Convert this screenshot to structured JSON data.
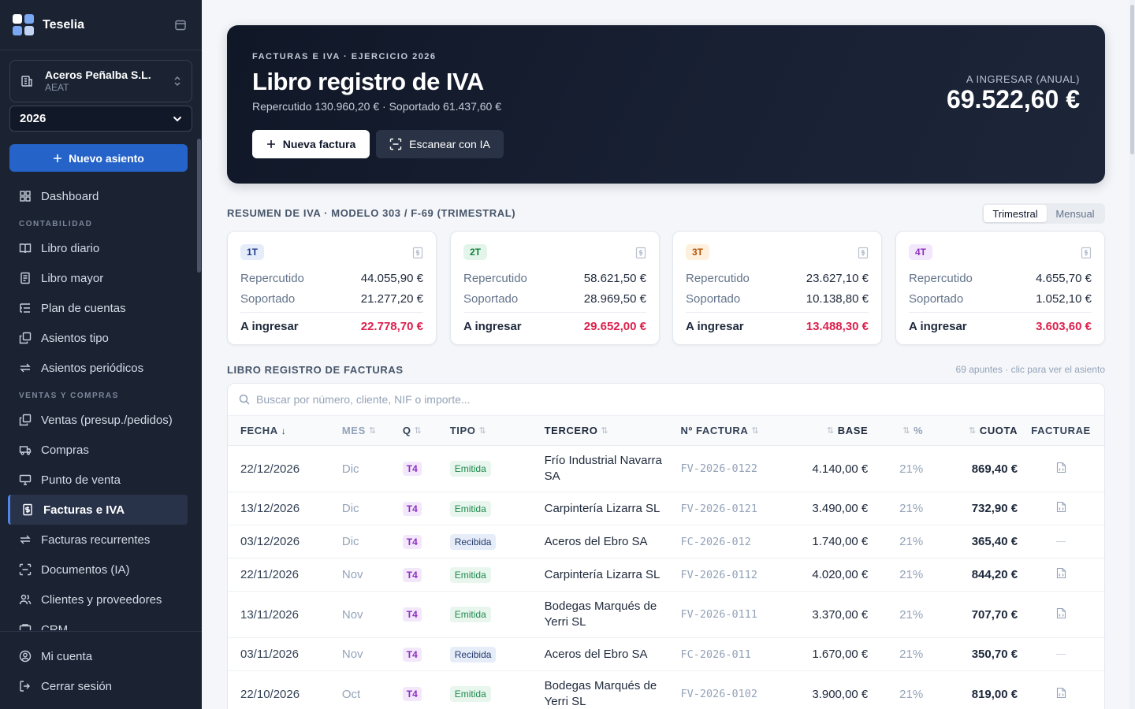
{
  "brand": {
    "name": "Teselia",
    "colors": [
      "#ffffff",
      "#7aa7f2",
      "#7aa7f2",
      "#c2d4f4"
    ]
  },
  "company": {
    "name": "Aceros Peñalba S.L.",
    "sub": "AEAT"
  },
  "year": "2026",
  "new_entry_label": "Nuevo asiento",
  "nav": {
    "dashboard": "Dashboard",
    "section_contabilidad": "CONTABILIDAD",
    "libro_diario": "Libro diario",
    "libro_mayor": "Libro mayor",
    "plan_cuentas": "Plan de cuentas",
    "asientos_tipo": "Asientos tipo",
    "asientos_periodicos": "Asientos periódicos",
    "section_ventas": "VENTAS Y COMPRAS",
    "ventas": "Ventas (presup./pedidos)",
    "compras": "Compras",
    "punto_venta": "Punto de venta",
    "facturas_iva": "Facturas e IVA",
    "facturas_recurrentes": "Facturas recurrentes",
    "documentos": "Documentos (IA)",
    "clientes": "Clientes y proveedores",
    "crm": "CRM",
    "mi_cuenta": "Mi cuenta",
    "cerrar_sesion": "Cerrar sesión"
  },
  "hero": {
    "eyebrow": "FACTURAS E IVA · EJERCICIO 2026",
    "title": "Libro registro de IVA",
    "subtitle": "Repercutido 130.960,20 € · Soportado 61.437,60 €",
    "btn_new": "Nueva factura",
    "btn_scan": "Escanear con IA",
    "total_label": "A INGRESAR (ANUAL)",
    "total_value": "69.522,60 €"
  },
  "summary": {
    "title": "RESUMEN DE IVA · MODELO 303 / F-69 (TRIMESTRAL)",
    "toggle_on": "Trimestral",
    "toggle_off": "Mensual",
    "labels": {
      "rep": "Repercutido",
      "sop": "Soportado",
      "ing": "A ingresar"
    },
    "quarters": [
      {
        "name": "1T",
        "color": "#1e3a8a",
        "bg": "#e5edfb",
        "rep": "44.055,90 €",
        "sop": "21.277,20 €",
        "ing": "22.778,70 €"
      },
      {
        "name": "2T",
        "color": "#15803d",
        "bg": "#e3f5ea",
        "rep": "58.621,50 €",
        "sop": "28.969,50 €",
        "ing": "29.652,00 €"
      },
      {
        "name": "3T",
        "color": "#b45309",
        "bg": "#fdf1de",
        "rep": "23.627,10 €",
        "sop": "10.138,80 €",
        "ing": "13.488,30 €"
      },
      {
        "name": "4T",
        "color": "#8e2fc2",
        "bg": "#f3e8fb",
        "rep": "4.655,70 €",
        "sop": "1.052,10 €",
        "ing": "3.603,60 €"
      }
    ]
  },
  "register": {
    "title": "LIBRO REGISTRO DE FACTURAS",
    "note": "69 apuntes · clic para ver el asiento",
    "search_placeholder": "Buscar por número, cliente, NIF o importe...",
    "columns": {
      "fecha": "FECHA",
      "mes": "MES",
      "q": "Q",
      "tipo": "TIPO",
      "tercero": "TERCERO",
      "num": "Nº FACTURA",
      "base": "BASE",
      "pct": "%",
      "cuota": "CUOTA",
      "facturae": "FACTURAE"
    },
    "rows": [
      {
        "fecha": "22/12/2026",
        "mes": "Dic",
        "q": "T4",
        "tipo": "Emitida",
        "tercero": "Frío Industrial Navarra SA",
        "num": "FV-2026-0122",
        "base": "4.140,00 €",
        "pct": "21%",
        "cuota": "869,40 €"
      },
      {
        "fecha": "13/12/2026",
        "mes": "Dic",
        "q": "T4",
        "tipo": "Emitida",
        "tercero": "Carpintería Lizarra SL",
        "num": "FV-2026-0121",
        "base": "3.490,00 €",
        "pct": "21%",
        "cuota": "732,90 €"
      },
      {
        "fecha": "03/12/2026",
        "mes": "Dic",
        "q": "T4",
        "tipo": "Recibida",
        "tercero": "Aceros del Ebro SA",
        "num": "FC-2026-012",
        "base": "1.740,00 €",
        "pct": "21%",
        "cuota": "365,40 €"
      },
      {
        "fecha": "22/11/2026",
        "mes": "Nov",
        "q": "T4",
        "tipo": "Emitida",
        "tercero": "Carpintería Lizarra SL",
        "num": "FV-2026-0112",
        "base": "4.020,00 €",
        "pct": "21%",
        "cuota": "844,20 €"
      },
      {
        "fecha": "13/11/2026",
        "mes": "Nov",
        "q": "T4",
        "tipo": "Emitida",
        "tercero": "Bodegas Marqués de Yerri SL",
        "num": "FV-2026-0111",
        "base": "3.370,00 €",
        "pct": "21%",
        "cuota": "707,70 €"
      },
      {
        "fecha": "03/11/2026",
        "mes": "Nov",
        "q": "T4",
        "tipo": "Recibida",
        "tercero": "Aceros del Ebro SA",
        "num": "FC-2026-011",
        "base": "1.670,00 €",
        "pct": "21%",
        "cuota": "350,70 €"
      },
      {
        "fecha": "22/10/2026",
        "mes": "Oct",
        "q": "T4",
        "tipo": "Emitida",
        "tercero": "Bodegas Marqués de Yerri SL",
        "num": "FV-2026-0102",
        "base": "3.900,00 €",
        "pct": "21%",
        "cuota": "819,00 €"
      }
    ]
  }
}
